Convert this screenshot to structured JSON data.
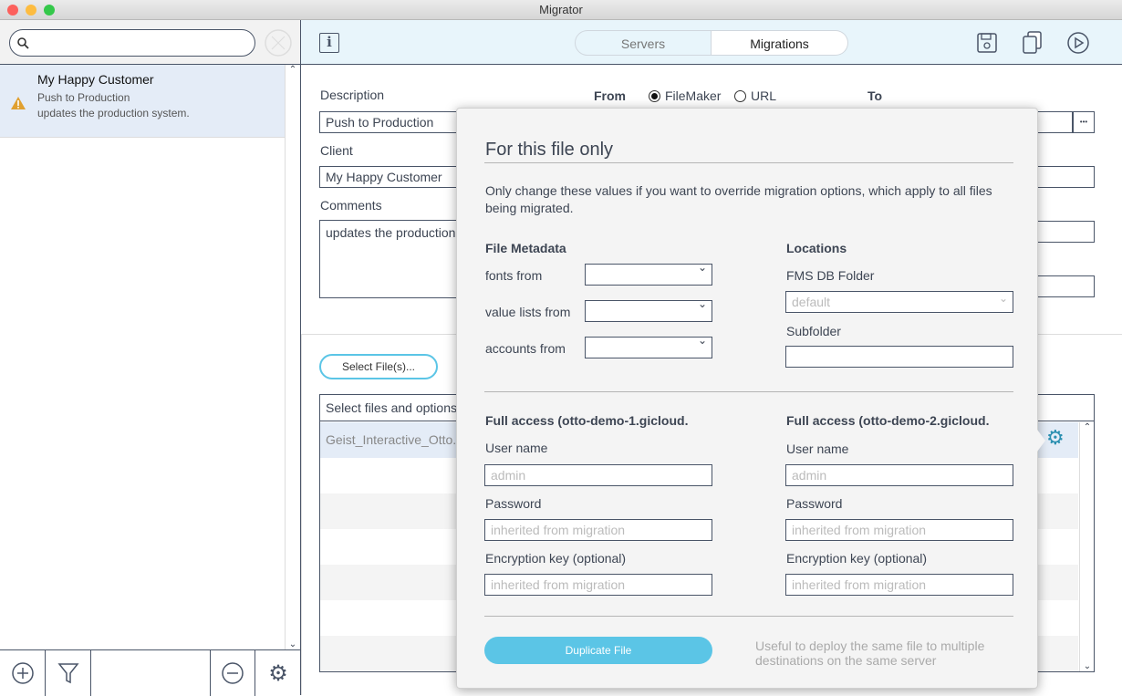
{
  "window": {
    "title": "Migrator"
  },
  "sidebar": {
    "search_placeholder": "",
    "items": [
      {
        "title": "My Happy Customer",
        "subtitle": "Push to Production",
        "detail": "updates the production system.",
        "status_icon": "warning-icon"
      }
    ]
  },
  "toolbar": {
    "tabs": [
      {
        "label": "Servers",
        "active": false
      },
      {
        "label": "Migrations",
        "active": true
      }
    ]
  },
  "form": {
    "description_label": "Description",
    "description_value": "Push to Production",
    "client_label": "Client",
    "client_value": "My Happy Customer",
    "comments_label": "Comments",
    "comments_value": "updates the production",
    "from_label": "From",
    "from_options": [
      "FileMaker",
      "URL"
    ],
    "from_selected": "FileMaker",
    "to_label": "To",
    "more_button": "•••"
  },
  "files": {
    "select_button": "Select File(s)...",
    "header": "Select files and options",
    "rows": [
      "Geist_Interactive_Otto."
    ]
  },
  "popover": {
    "title": "For this file only",
    "intro": "Only change these values if you want to override migration options, which apply to all files being migrated.",
    "metadata_title": "File Metadata",
    "fonts_label": "fonts from",
    "value_lists_label": "value lists from",
    "accounts_label": "accounts from",
    "locations_title": "Locations",
    "fms_folder_label": "FMS DB Folder",
    "fms_folder_value": "default",
    "subfolder_label": "Subfolder",
    "left": {
      "title": "Full access (otto-demo-1.gicloud.",
      "user_label": "User name",
      "user_placeholder": "admin",
      "password_label": "Password",
      "password_placeholder": "inherited from migration",
      "key_label": "Encryption key (optional)",
      "key_placeholder": "inherited from migration"
    },
    "right": {
      "title": "Full access  (otto-demo-2.gicloud.",
      "user_label": "User name",
      "user_placeholder": "admin",
      "password_label": "Password",
      "password_placeholder": "inherited from migration",
      "key_label": "Encryption key (optional)",
      "key_placeholder": "inherited from migration"
    },
    "duplicate_button": "Duplicate File",
    "duplicate_help": "Useful to deploy the same file to multiple destinations on the same server"
  },
  "colors": {
    "accent": "#5bc5e6",
    "toolbar_bg": "#e8f5fb",
    "selection": "#e4ecf7",
    "warning": "#e0a030"
  }
}
